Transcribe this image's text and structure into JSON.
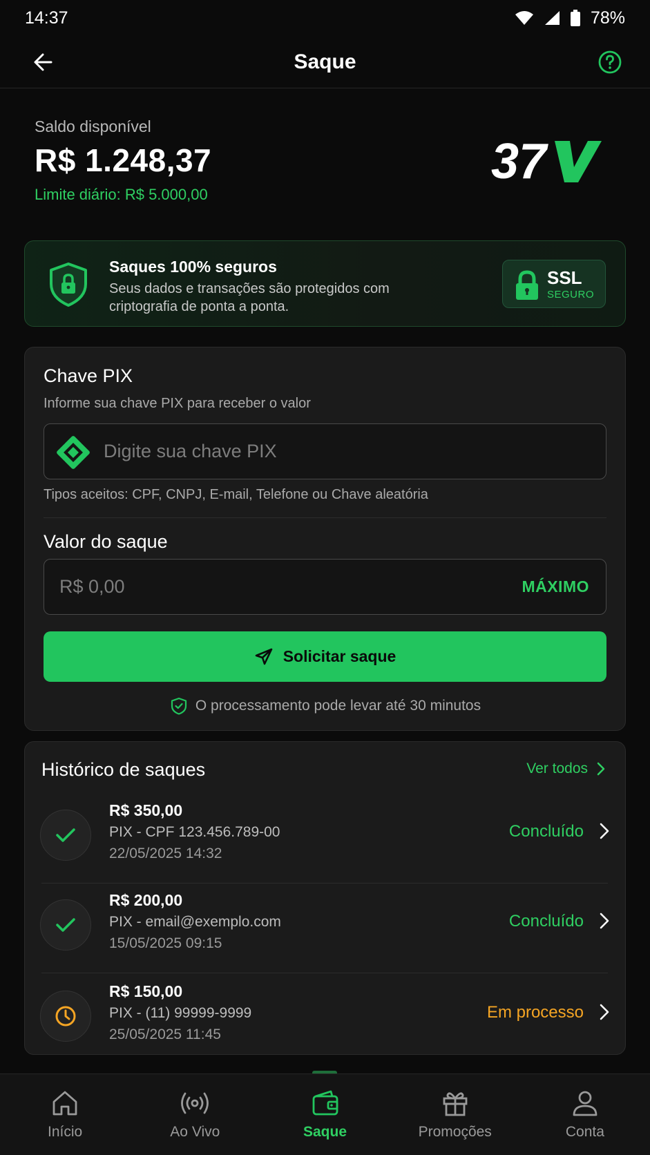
{
  "status_bar": {
    "time": "14:37",
    "battery": "78%",
    "icons": [
      "wifi-icon",
      "signal-icon",
      "battery-icon"
    ]
  },
  "header": {
    "title": "Saque",
    "back_icon": "arrow-left-icon",
    "help_icon": "help-circle-icon"
  },
  "balance": {
    "label": "Saldo disponível",
    "amount": "R$ 1.248,37",
    "daily_limit": "Limite diário: R$ 5.000,00"
  },
  "security": {
    "title": "Saques 100% seguros",
    "text": "Seus dados e transações são protegidos com criptografia de ponta a ponta.",
    "badge_title": "SSL",
    "badge_sub": "SEGURO"
  },
  "pix_form": {
    "title": "Chave PIX",
    "subtitle": "Informe sua chave PIX para receber o valor",
    "key_placeholder": "Digite sua chave PIX",
    "key_value": "",
    "accepted_types": "Tipos aceitos: CPF, CNPJ, E-mail, Telefone ou Chave aleatória",
    "amount_label": "Valor do saque",
    "amount_placeholder": "R$ 0,00",
    "amount_value": "",
    "max_label": "MÁXIMO",
    "submit_label": "Solicitar saque",
    "processing_note": "O processamento pode levar até 30 minutos"
  },
  "history": {
    "title": "Histórico de saques",
    "see_all": "Ver todos",
    "items": [
      {
        "amount": "R$ 350,00",
        "description": "PIX - CPF 123.456.789-00",
        "date": "22/05/2025 14:32",
        "status": "Concluído",
        "status_icon": "check-icon"
      },
      {
        "amount": "R$ 200,00",
        "description": "PIX - email@exemplo.com",
        "date": "15/05/2025 09:15",
        "status": "Concluído",
        "status_icon": "check-icon"
      },
      {
        "amount": "R$ 150,00",
        "description": "PIX - (11) 99999-9999",
        "date": "25/05/2025 11:45",
        "status": "Em processo",
        "status_icon": "clock-icon"
      }
    ]
  },
  "bottom_nav": [
    {
      "label": "Início",
      "icon": "home-icon"
    },
    {
      "label": "Ao Vivo",
      "icon": "broadcast-icon"
    },
    {
      "label": "Saque",
      "icon": "wallet-icon",
      "active": true
    },
    {
      "label": "Promoções",
      "icon": "gift-icon"
    },
    {
      "label": "Conta",
      "icon": "user-icon"
    }
  ],
  "colors": {
    "accent": "#22c55e",
    "accent_text": "#2fcf62",
    "pending": "#f5a524",
    "background": "#0b0b0b",
    "card": "#1b1b1b"
  }
}
